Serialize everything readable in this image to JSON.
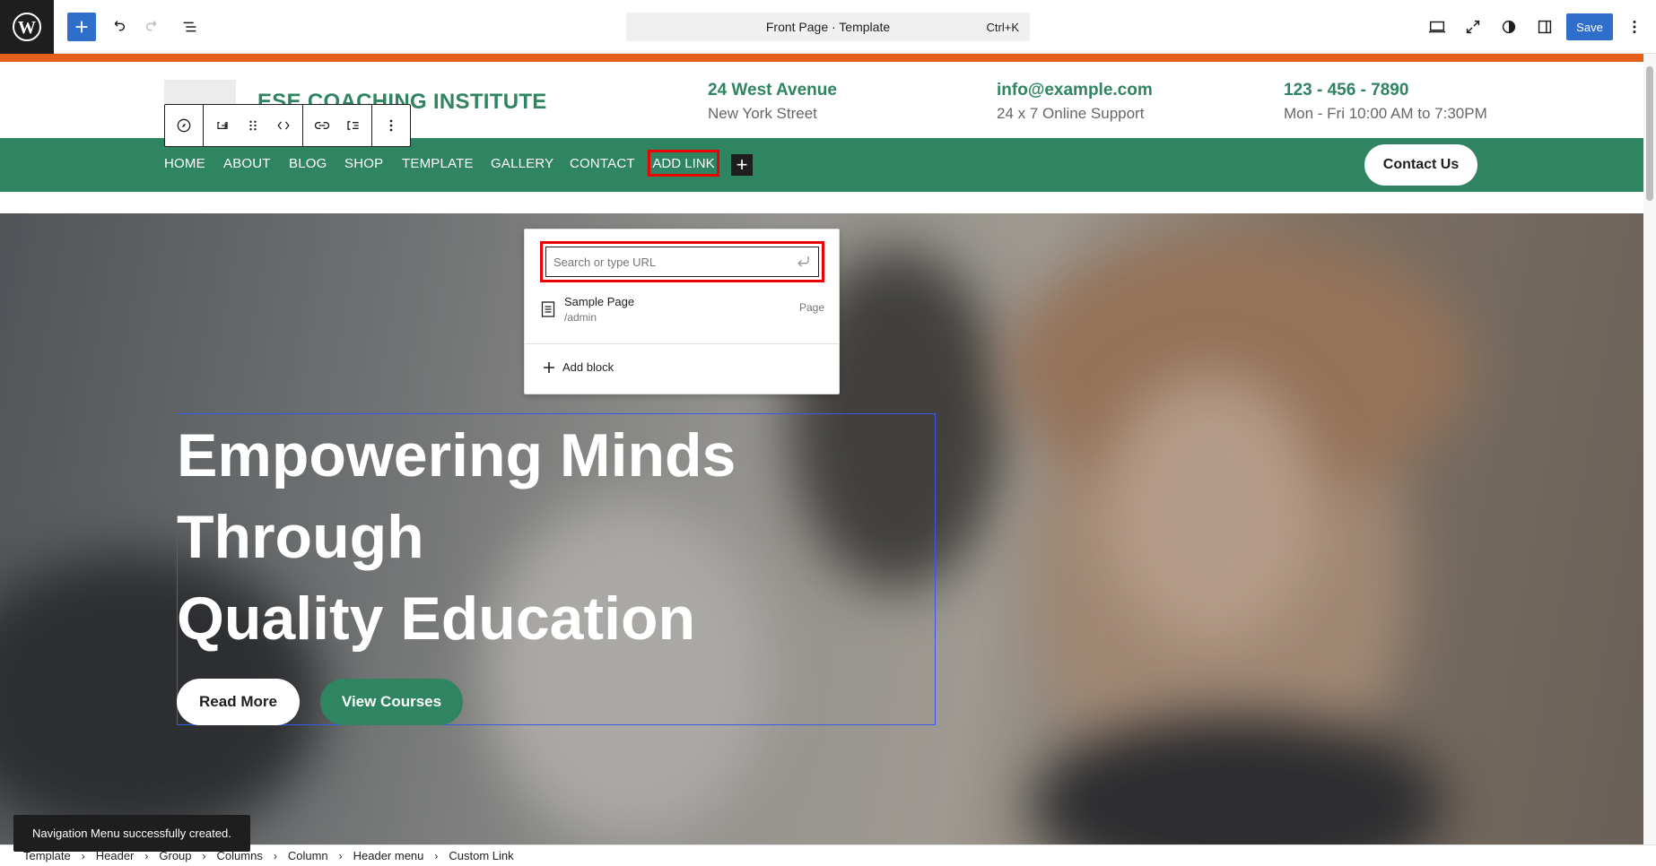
{
  "topbar": {
    "command_label": "Front Page · Template",
    "command_shortcut": "Ctrl+K",
    "save_label": "Save"
  },
  "header": {
    "site_title": "ESE COACHING INSTITUTE",
    "address_line1": "24 West Avenue",
    "address_line2": "New York Street",
    "email": "info@example.com",
    "support": "24 x 7 Online Support",
    "phone": "123 - 456 - 7890",
    "hours": "Mon - Fri 10:00 AM to 7:30PM"
  },
  "nav": {
    "items": [
      "HOME",
      "ABOUT",
      "BLOG",
      "SHOP",
      "TEMPLATE",
      "GALLERY",
      "CONTACT"
    ],
    "add_link_label": "ADD LINK",
    "plus": "+",
    "contact_button": "Contact Us"
  },
  "link_popover": {
    "search_placeholder": "Search or type URL",
    "suggestion_title": "Sample Page",
    "suggestion_url": "/admin",
    "suggestion_kind": "Page",
    "add_block_label": "Add block"
  },
  "hero": {
    "title_line1": "Empowering Minds",
    "title_line2": "Through",
    "title_line3": "Quality Education",
    "read_more": "Read More",
    "view_courses": "View Courses"
  },
  "snackbar": {
    "message": "Navigation Menu successfully created."
  },
  "breadcrumb": [
    "Template",
    "Header",
    "Group",
    "Columns",
    "Column",
    "Header menu",
    "Custom Link"
  ],
  "colors": {
    "brand_green": "#2f8461",
    "accent_orange": "#e4601a",
    "wp_blue": "#2f6fcb",
    "highlight_red": "#e00000"
  }
}
